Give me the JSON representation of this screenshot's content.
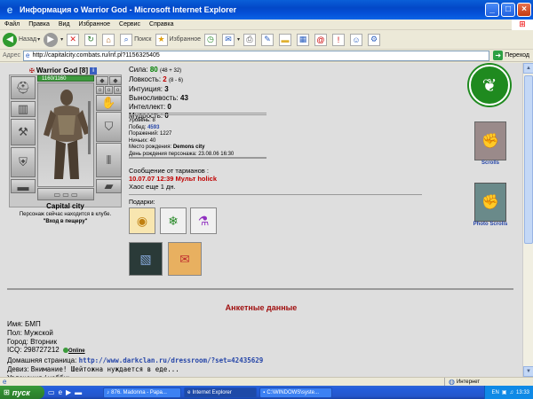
{
  "window": {
    "title": "Информация о Warrior God - Microsoft Internet Explorer",
    "minimize": "_",
    "maximize": "□",
    "close": "×"
  },
  "menu": [
    "Файл",
    "Правка",
    "Вид",
    "Избранное",
    "Сервис",
    "Справка"
  ],
  "toolbar": {
    "back": "Назад",
    "search": "Поиск",
    "favorites": "Избранное"
  },
  "address": {
    "label": "Адрес",
    "url": "http://capitalcity.combats.ru/inf.pl?1156325405",
    "go": "Переход"
  },
  "character": {
    "name": "Warrior God",
    "level": "[8]",
    "info_icon": "i",
    "hp": "1160/1160",
    "city": "Capital city",
    "location_line1": "Персонаж сейчас находится в клубе.",
    "location_line2": "\"Вход в пещеру\""
  },
  "stats": {
    "strength_label": "Сила:",
    "strength_value": "80",
    "strength_sub": "(48 + 32)",
    "agility_label": "Ловкость:",
    "agility_value": "2",
    "agility_sub": "(8 - 6)",
    "intuition_label": "Интуиция:",
    "intuition_value": "3",
    "endurance_label": "Выносливость:",
    "endurance_value": "43",
    "intellect_label": "Интеллект:",
    "intellect_value": "0",
    "wisdom_label": "Мудрость:",
    "wisdom_value": "0"
  },
  "record": {
    "level_label": "Уровень:",
    "level_value": "8",
    "wins_label": "Побед:",
    "wins_value": "4593",
    "losses_label": "Поражений:",
    "losses_value": "1227",
    "draws_label": "Ничьих:",
    "draws_value": "40",
    "birthplace_label": "Место рождения:",
    "birthplace_value": "Demons city",
    "birthday_label": "День рождения персонажа:",
    "birthday_value": "23.08.06 16:30"
  },
  "message": {
    "heading": "Сообщение от тарманов :",
    "line": "10.07.07 12:39 Мульт holick",
    "chaos": "Хаос еще 1 дн."
  },
  "gifts": {
    "title": "Подарки:"
  },
  "side_links": {
    "scrolls": "Scrolls",
    "photo_scrolls": "Photo Scrolls"
  },
  "profile": {
    "title": "Анкетные данные",
    "name_label": "Имя:",
    "name_value": "БМП",
    "gender_label": "Пол:",
    "gender_value": "Мужской",
    "city_label": "Город:",
    "city_value": "Вторник",
    "icq_label": "ICQ:",
    "icq_value": "298727212",
    "online_label": "Online",
    "homepage_label": "Домашняя страница:",
    "homepage_value": "http://www.darkclan.ru/dressroom/?set=42435629",
    "motto_label": "Девиз:",
    "motto_value": "Внимание! Шейтожна нуждается в еде...",
    "hobby_label": "Увлечения / хобби:"
  },
  "status": {
    "zone": "Интернет"
  },
  "taskbar": {
    "start": "пуск",
    "task1": "876. Madonna - Papa...",
    "task2": "Internet Explorer",
    "task3": "C:\\WINDOWS\\syste...",
    "clock": "13:33"
  },
  "colors": {
    "titlebar": "#0348c8",
    "profile_title": "#a01010",
    "stat_green": "#008000",
    "stat_red": "#c00000",
    "link_blue": "#2545a8"
  }
}
